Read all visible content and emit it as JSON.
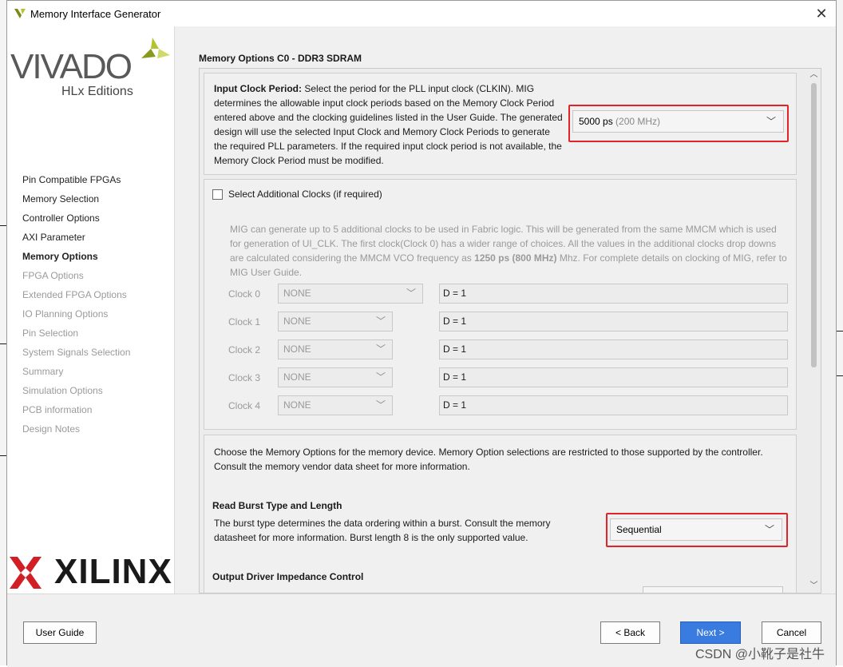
{
  "window": {
    "title": "Memory Interface Generator",
    "close_glyph": "✕"
  },
  "branding": {
    "product": "VIVADO",
    "edition": "HLx Editions",
    "vendor": "XILINX",
    "accent_color": "#b5c32e"
  },
  "sidebar": {
    "items": [
      {
        "label": "Pin Compatible FPGAs",
        "state": "done"
      },
      {
        "label": "Memory Selection",
        "state": "done"
      },
      {
        "label": "Controller Options",
        "state": "done"
      },
      {
        "label": "AXI Parameter",
        "state": "done"
      },
      {
        "label": "Memory Options",
        "state": "active"
      },
      {
        "label": "FPGA Options",
        "state": "pending"
      },
      {
        "label": "Extended FPGA Options",
        "state": "pending"
      },
      {
        "label": "IO Planning Options",
        "state": "pending"
      },
      {
        "label": "Pin Selection",
        "state": "pending"
      },
      {
        "label": "System Signals Selection",
        "state": "pending"
      },
      {
        "label": "Summary",
        "state": "pending"
      },
      {
        "label": "Simulation Options",
        "state": "pending"
      },
      {
        "label": "PCB information",
        "state": "pending"
      },
      {
        "label": "Design Notes",
        "state": "pending"
      }
    ]
  },
  "main": {
    "section_title": "Memory Options C0 - DDR3 SDRAM",
    "input_clock": {
      "label": "Input Clock Period:",
      "description": " Select the period for the PLL input clock (CLKIN). MIG determines the allowable input clock periods based on the Memory Clock Period entered above and the clocking guidelines listed in the User Guide. The generated design will use the selected Input Clock and Memory Clock Periods to generate the required PLL parameters. If the required input clock period is not available, the Memory Clock Period must be modified.",
      "value": "5000 ps",
      "value_detail": "(200 MHz)"
    },
    "additional_clocks": {
      "checkbox_label": "Select Additional Clocks (if required)",
      "checked": false,
      "note_part1": "MIG can generate up to 5 additional clocks to be used in Fabric logic. This will be generated from the same MMCM which is used for generation of UI_CLK. The first clock(Clock 0) has a wider range of choices. All the values in the additional clocks drop downs are calculated considering the MMCM VCO frequency as ",
      "note_bold": "1250 ps (800 MHz)",
      "note_part2": " Mhz. For complete details on clocking of MIG, refer to MIG User Guide.",
      "clocks": [
        {
          "label": "Clock 0",
          "selection": "NONE",
          "divider": "D = 1"
        },
        {
          "label": "Clock 1",
          "selection": "NONE",
          "divider": "D = 1"
        },
        {
          "label": "Clock 2",
          "selection": "NONE",
          "divider": "D = 1"
        },
        {
          "label": "Clock 3",
          "selection": "NONE",
          "divider": "D = 1"
        },
        {
          "label": "Clock 4",
          "selection": "NONE",
          "divider": "D = 1"
        }
      ]
    },
    "memory_options": {
      "intro": "Choose the Memory Options for the memory device. Memory Option selections are restricted to those supported by the controller. Consult the memory vendor data sheet for more information.",
      "burst_heading": "Read Burst Type and Length",
      "burst_description": "The burst type determines the data ordering within a burst. Consult the memory datasheet for more information. Burst length 8 is the only supported value.",
      "burst_value": "Sequential",
      "odi_heading": "Output Driver Impedance Control"
    },
    "highlight_color": "#e0242a"
  },
  "buttons": {
    "user_guide": "User Guide",
    "back": "< Back",
    "next": "Next >",
    "cancel": "Cancel"
  },
  "watermark": "CSDN @小靴子是社牛"
}
